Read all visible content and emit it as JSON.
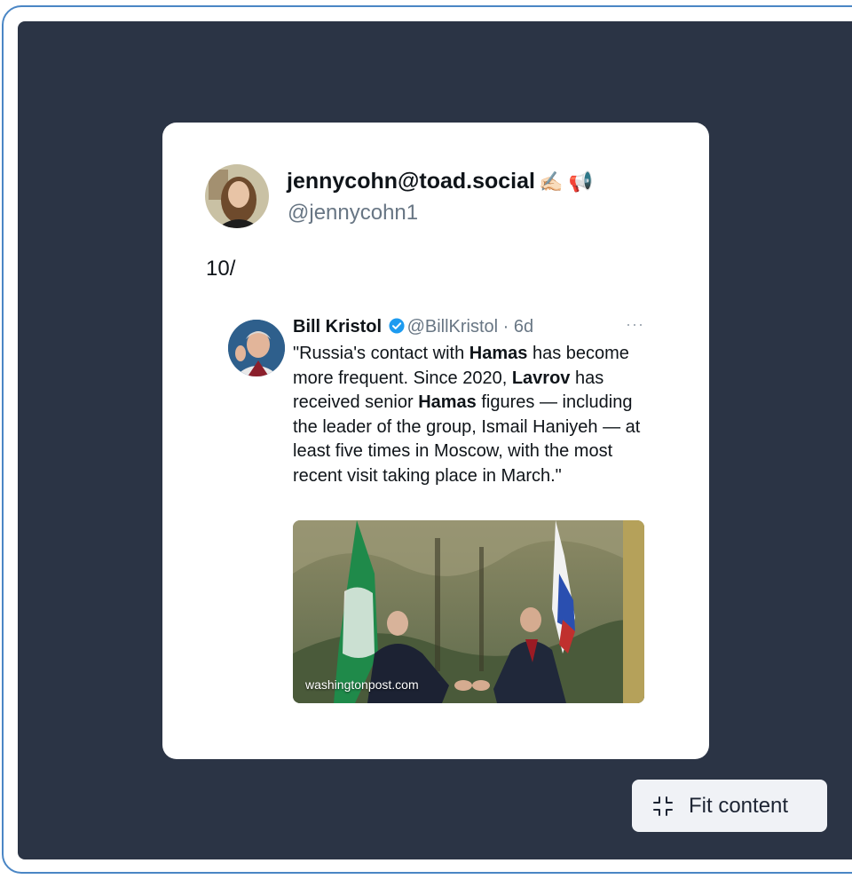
{
  "post": {
    "author_name": "jennycohn@toad.social",
    "author_emoji": "✍🏻 📢",
    "author_handle": "@jennycohn1",
    "text": "10/"
  },
  "quoted_tweet": {
    "name": "Bill Kristol",
    "handle": "@BillKristol",
    "age": "6d",
    "more": "···",
    "body": [
      {
        "t": "\"Russia's contact with ",
        "b": false
      },
      {
        "t": "Hamas",
        "b": true
      },
      {
        "t": " has become more frequent. Since 2020, ",
        "b": false
      },
      {
        "t": "Lavrov",
        "b": true
      },
      {
        "t": " has received senior ",
        "b": false
      },
      {
        "t": "Hamas",
        "b": true
      },
      {
        "t": " figures — including the leader of the group, Ismail Haniyeh — at least five times in Moscow, with the most recent visit taking place in March.\"",
        "b": false
      }
    ],
    "media_source": "washingtonpost.com"
  },
  "controls": {
    "fit_label": "Fit content"
  },
  "colors": {
    "canvas_bg": "#2b3445",
    "frame_border": "#4a86c5",
    "verified_blue": "#1d9bf0"
  }
}
